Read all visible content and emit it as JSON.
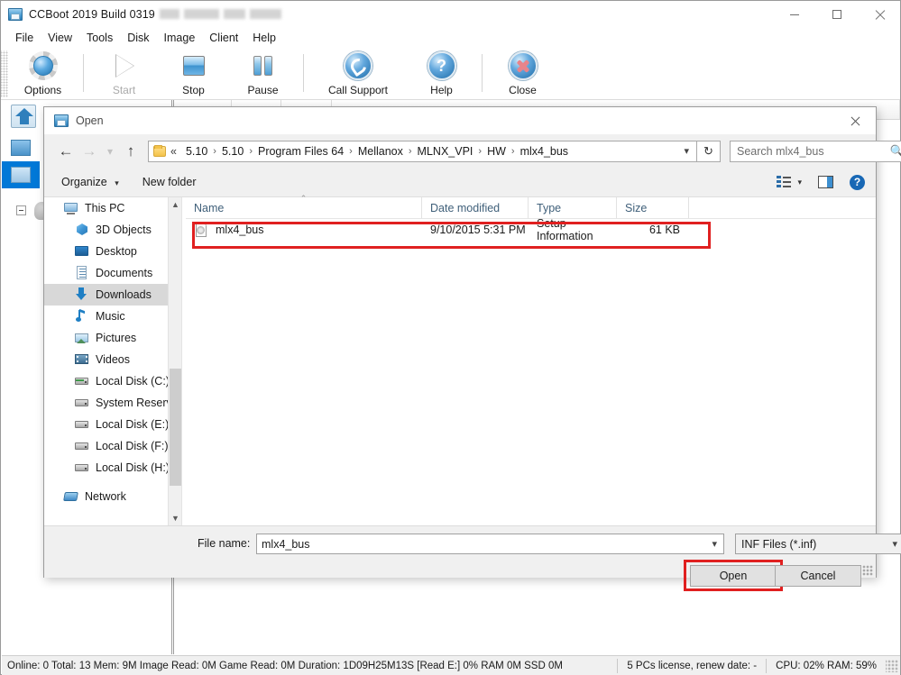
{
  "app": {
    "title": "CCBoot 2019 Build 0319",
    "title_suffix_redacted": true,
    "icon": "ccboot-disk-icon",
    "window_controls": {
      "minimize": "minimize-icon",
      "maximize": "maximize-icon",
      "close": "close-icon"
    },
    "menu": [
      {
        "label": "File"
      },
      {
        "label": "View"
      },
      {
        "label": "Tools"
      },
      {
        "label": "Disk"
      },
      {
        "label": "Image"
      },
      {
        "label": "Client"
      },
      {
        "label": "Help"
      }
    ],
    "toolbar": [
      {
        "label": "Options",
        "icon": "gear-icon",
        "disabled": false
      },
      {
        "label": "Start",
        "icon": "play-icon",
        "disabled": true
      },
      {
        "label": "Stop",
        "icon": "stop-icon",
        "disabled": false
      },
      {
        "label": "Pause",
        "icon": "pause-icon",
        "disabled": false
      },
      {
        "label": "Call Support",
        "icon": "phone-icon",
        "disabled": false
      },
      {
        "label": "Help",
        "icon": "question-icon",
        "disabled": false
      },
      {
        "label": "Close",
        "icon": "close-x-icon",
        "disabled": false
      }
    ]
  },
  "status_bar": {
    "left": "Online: 0 Total: 13 Mem: 9M Image Read: 0M Game Read: 0M Duration: 1D09H25M13S [Read E:] 0% RAM 0M SSD 0M",
    "license": "5 PCs license, renew date: -",
    "resources": "CPU: 02% RAM: 59%"
  },
  "dialog": {
    "title": "Open",
    "icon": "folder-disk-icon",
    "close_label": "close-icon",
    "nav": {
      "back": "back-arrow-icon",
      "forward": "forward-arrow-icon",
      "recent": "recent-locations-icon",
      "up": "up-arrow-icon"
    },
    "address": {
      "folder_icon": "folder-icon",
      "prefix": "«",
      "crumbs": [
        "5.10",
        "5.10",
        "Program Files 64",
        "Mellanox",
        "MLNX_VPI",
        "HW",
        "mlx4_bus"
      ],
      "separator": "›",
      "dropdown_icon": "chevron-down-icon",
      "refresh_icon": "refresh-icon"
    },
    "search": {
      "placeholder": "Search mlx4_bus",
      "icon": "search-icon"
    },
    "command_bar": {
      "organize": "Organize",
      "new_folder": "New folder",
      "view_icon": "view-layout-icon",
      "preview_pane_icon": "preview-pane-icon",
      "help_icon": "help-icon"
    },
    "nav_pane": {
      "items": [
        {
          "label": "This PC",
          "icon": "this-pc-icon",
          "level": 0,
          "selected": false
        },
        {
          "label": "3D Objects",
          "icon": "3d-objects-icon",
          "level": 1,
          "selected": false
        },
        {
          "label": "Desktop",
          "icon": "desktop-icon",
          "level": 1,
          "selected": false
        },
        {
          "label": "Documents",
          "icon": "documents-icon",
          "level": 1,
          "selected": false
        },
        {
          "label": "Downloads",
          "icon": "downloads-icon",
          "level": 1,
          "selected": true
        },
        {
          "label": "Music",
          "icon": "music-icon",
          "level": 1,
          "selected": false
        },
        {
          "label": "Pictures",
          "icon": "pictures-icon",
          "level": 1,
          "selected": false
        },
        {
          "label": "Videos",
          "icon": "videos-icon",
          "level": 1,
          "selected": false
        },
        {
          "label": "Local Disk (C:)",
          "icon": "drive-system-icon",
          "level": 1,
          "selected": false
        },
        {
          "label": "System Reserved",
          "icon": "drive-icon",
          "level": 1,
          "selected": false
        },
        {
          "label": "Local Disk (E:)",
          "icon": "drive-icon",
          "level": 1,
          "selected": false
        },
        {
          "label": "Local Disk (F:)",
          "icon": "drive-icon",
          "level": 1,
          "selected": false
        },
        {
          "label": "Local Disk (H:)",
          "icon": "drive-icon",
          "level": 1,
          "selected": false
        },
        {
          "label": "Network",
          "icon": "network-icon",
          "level": 0,
          "selected": false
        }
      ],
      "scrollbar": {
        "up_icon": "chevron-up-icon",
        "down_icon": "chevron-down-icon"
      }
    },
    "file_list": {
      "columns": [
        {
          "label": "Name",
          "sorted": true,
          "sort_caret": "˄"
        },
        {
          "label": "Date modified",
          "sorted": false
        },
        {
          "label": "Type",
          "sorted": false
        },
        {
          "label": "Size",
          "sorted": false
        }
      ],
      "rows": [
        {
          "name": "mlx4_bus",
          "date_modified": "9/10/2015 5:31 PM",
          "type": "Setup Information",
          "size": "61 KB",
          "icon": "inf-file-icon",
          "highlighted": true
        }
      ],
      "highlight_color": "#e02020"
    },
    "footer": {
      "filename_label": "File name:",
      "filename_value": "mlx4_bus",
      "filename_caret": "chevron-down-icon",
      "filter_value": "INF Files (*.inf)",
      "filter_caret": "chevron-down-icon",
      "open_button": "Open",
      "cancel_button": "Cancel",
      "open_highlight_color": "#e02020",
      "resize_grip": "resize-grip-icon"
    }
  }
}
